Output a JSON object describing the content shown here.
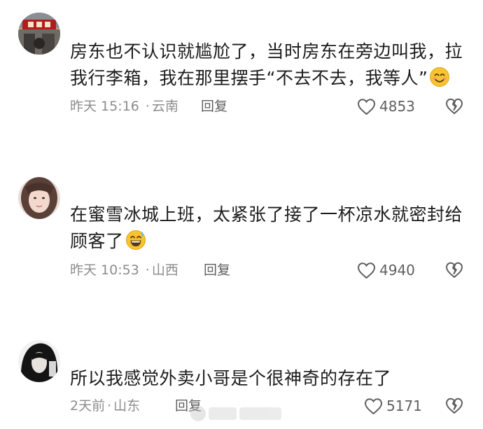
{
  "comments": [
    {
      "text": "房东也不认识就尴尬了，当时房东在旁边叫我，拉我行李箱，我在那里摆手“不去不去，我等人”",
      "emoji": "smiling-face-with-smiling-eyes",
      "time": "昨天 15:16",
      "location": "云南",
      "reply_label": "回复",
      "likes": "4853"
    },
    {
      "text": "在蜜雪冰城上班，太紧张了接了一杯凉水就密封给顾客了",
      "emoji": "grinning-face-with-sweat",
      "time": "昨天 10:53",
      "location": "山西",
      "reply_label": "回复",
      "likes": "4940"
    },
    {
      "text": "所以我感觉外卖小哥是个很神奇的存在了",
      "emoji": "",
      "time": "2天前",
      "location": "山东",
      "reply_label": "回复",
      "likes": "5171"
    }
  ],
  "separator": "·",
  "colors": {
    "text": "#1c1c1c",
    "meta": "#8c8c8c",
    "icon": "#5f5f5f",
    "background": "#ffffff"
  }
}
